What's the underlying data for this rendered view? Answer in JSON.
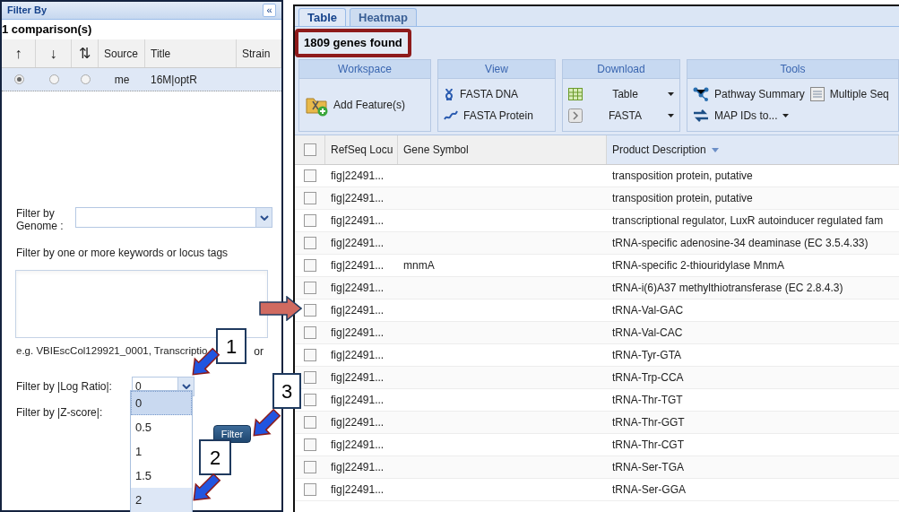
{
  "filter_panel": {
    "title": "Filter By",
    "collapse_button": "«",
    "comparisons_label": "1 comparison(s)",
    "columns": [
      "↑",
      "↓",
      "⇅",
      "Source",
      "Title",
      "Strain"
    ],
    "comparisons": [
      {
        "radios": [
          {
            "selected": true
          },
          {
            "selected": false
          },
          {
            "selected": false
          }
        ],
        "source": "me",
        "title": "16M|optR",
        "selected": true
      }
    ],
    "genome_label": "Filter by Genome :",
    "keyword_label": "Filter by one or more keywords or locus tags",
    "keyword_hint_parts": [
      "e.g. VBIEscCol129921_0001, Transcriptio",
      "or"
    ],
    "log_ratio_label": "Filter by |Log Ratio|:",
    "log_ratio_value": "0",
    "log_ratio_options": [
      {
        "label": "0",
        "selected": true,
        "highlighted": false
      },
      {
        "label": "0.5",
        "selected": false,
        "highlighted": false
      },
      {
        "label": "1",
        "selected": false,
        "highlighted": false
      },
      {
        "label": "1.5",
        "selected": false,
        "highlighted": false
      },
      {
        "label": "2",
        "selected": false,
        "highlighted": true
      }
    ],
    "zscore_label": "Filter by |Z-score|:",
    "filter_button": "Filter"
  },
  "results_panel": {
    "tabs": [
      {
        "label": "Table",
        "selected": true
      },
      {
        "label": "Heatmap",
        "selected": false
      }
    ],
    "result_count": "1809 genes found",
    "toolbar": [
      {
        "title": "Workspace",
        "rows": [
          [
            {
              "label": "Add Feature(s)",
              "dropdown": false
            }
          ]
        ]
      },
      {
        "title": "View",
        "rows": [
          [
            {
              "label": "FASTA DNA",
              "dropdown": false
            }
          ],
          [
            {
              "label": "FASTA Protein",
              "dropdown": false
            }
          ]
        ]
      },
      {
        "title": "Download",
        "rows": [
          [
            {
              "label": "Table",
              "dropdown": true
            }
          ],
          [
            {
              "label": "FASTA",
              "dropdown": true
            }
          ]
        ]
      },
      {
        "title": "Tools",
        "rows": [
          [
            {
              "label": "Pathway Summary",
              "dropdown": false
            },
            {
              "label": "Multiple Seq",
              "dropdown": false
            }
          ],
          [
            {
              "label": "MAP IDs to...",
              "dropdown": true
            }
          ]
        ]
      }
    ],
    "table": {
      "select_all": {
        "checked": false
      },
      "columns": [
        {
          "label": "RefSeq Locu",
          "sorted": false
        },
        {
          "label": "Gene Symbol",
          "sorted": false
        },
        {
          "label": "Product Description",
          "sorted": true
        }
      ],
      "rows": [
        {
          "checked": false,
          "locus": "fig|22491...",
          "description": "transposition protein, putative"
        },
        {
          "checked": false,
          "locus": "fig|22491...",
          "description": "transposition protein, putative"
        },
        {
          "checked": false,
          "locus": "fig|22491...",
          "description": "transcriptional regulator, LuxR autoinducer regulated fam"
        },
        {
          "checked": false,
          "locus": "fig|22491...",
          "description": "tRNA-specific adenosine-34 deaminase (EC 3.5.4.33)"
        },
        {
          "checked": false,
          "locus": "fig|22491...",
          "gene": "mnmA",
          "description": "tRNA-specific 2-thiouridylase MnmA"
        },
        {
          "checked": false,
          "locus": "fig|22491...",
          "description": "tRNA-i(6)A37 methylthiotransferase (EC 2.8.4.3)"
        },
        {
          "checked": false,
          "locus": "fig|22491...",
          "description": "tRNA-Val-GAC"
        },
        {
          "checked": false,
          "locus": "fig|22491...",
          "description": "tRNA-Val-CAC"
        },
        {
          "checked": false,
          "locus": "fig|22491...",
          "description": "tRNA-Tyr-GTA"
        },
        {
          "checked": false,
          "locus": "fig|22491...",
          "description": "tRNA-Trp-CCA"
        },
        {
          "checked": false,
          "locus": "fig|22491...",
          "description": "tRNA-Thr-TGT"
        },
        {
          "checked": false,
          "locus": "fig|22491...",
          "description": "tRNA-Thr-GGT"
        },
        {
          "checked": false,
          "locus": "fig|22491...",
          "description": "tRNA-Thr-CGT"
        },
        {
          "checked": false,
          "locus": "fig|22491...",
          "description": "tRNA-Ser-TGA"
        },
        {
          "checked": false,
          "locus": "fig|22491...",
          "description": "tRNA-Ser-GGA"
        }
      ]
    }
  },
  "callouts": [
    {
      "label": "1"
    },
    {
      "label": "2"
    },
    {
      "label": "3"
    }
  ]
}
